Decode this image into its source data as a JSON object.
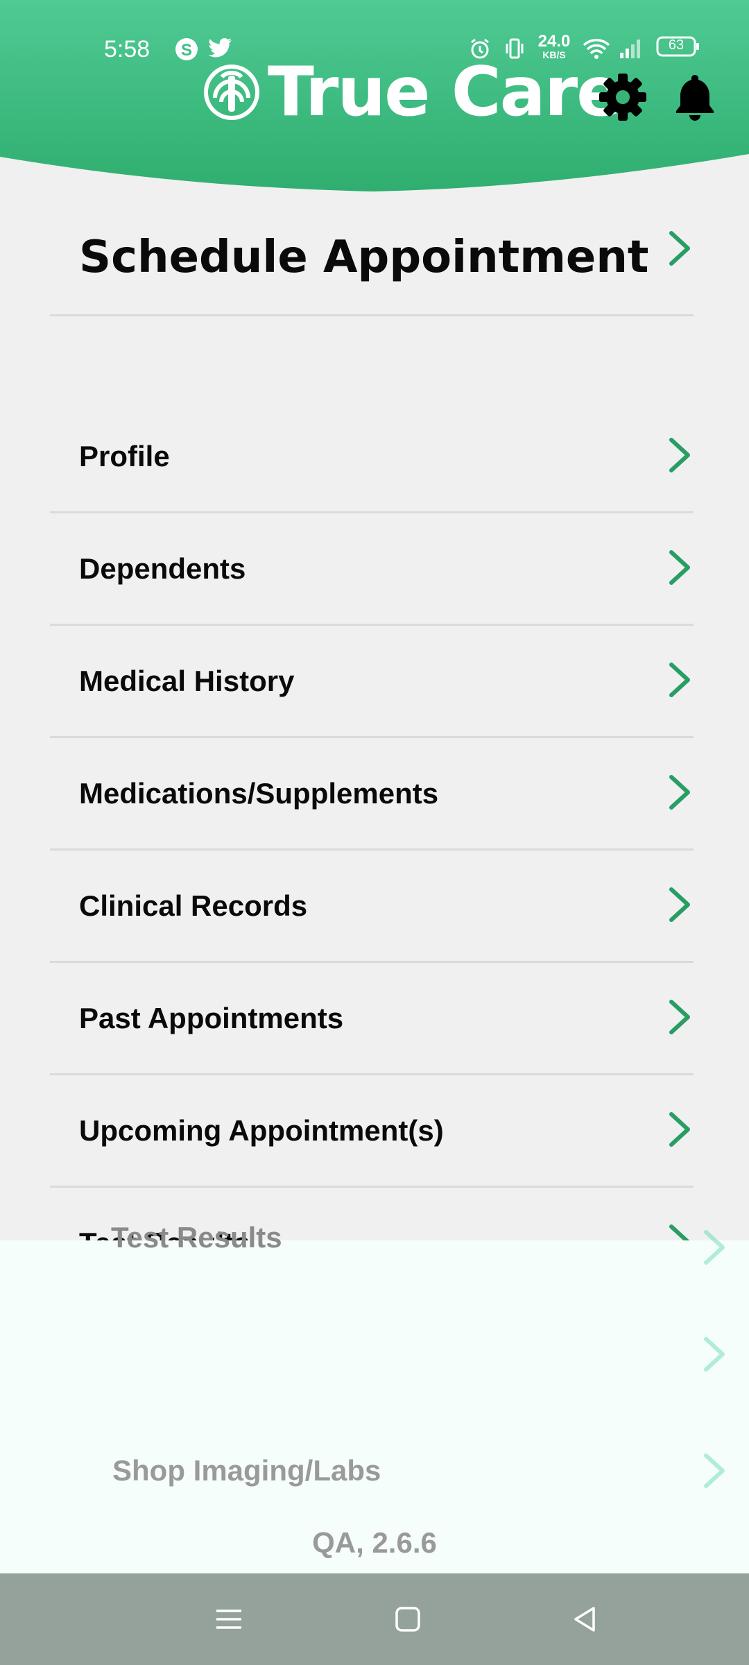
{
  "status_bar": {
    "time": "5:58",
    "net_speed": "24.0",
    "net_unit": "KB/S",
    "battery": "63",
    "icons": [
      "skype-icon",
      "twitter-icon",
      "alarm-icon",
      "vibrate-icon",
      "wifi-icon",
      "signal-icon",
      "battery-icon"
    ]
  },
  "header": {
    "brand": "True Care",
    "accent_color": "#33b77a",
    "icons": [
      "settings-gear-icon",
      "notification-bell-icon"
    ]
  },
  "menu": {
    "schedule": "Schedule Appointment",
    "items": [
      {
        "label": "Profile"
      },
      {
        "label": "Dependents"
      },
      {
        "label": "Medical History"
      },
      {
        "label": "Medications/Supplements"
      },
      {
        "label": "Clinical Records"
      },
      {
        "label": "Past Appointments"
      },
      {
        "label": "Upcoming Appointment(s)"
      },
      {
        "label": "Test Results"
      }
    ],
    "chevron_color": "#2a9d63"
  },
  "overlay": {
    "ghost_title": "Test Results",
    "shop_label": "Shop Imaging/Labs",
    "version": "QA, 2.6.6"
  },
  "nav_bar": {
    "icons": [
      "menu-icon",
      "home-square-icon",
      "back-triangle-icon"
    ]
  }
}
